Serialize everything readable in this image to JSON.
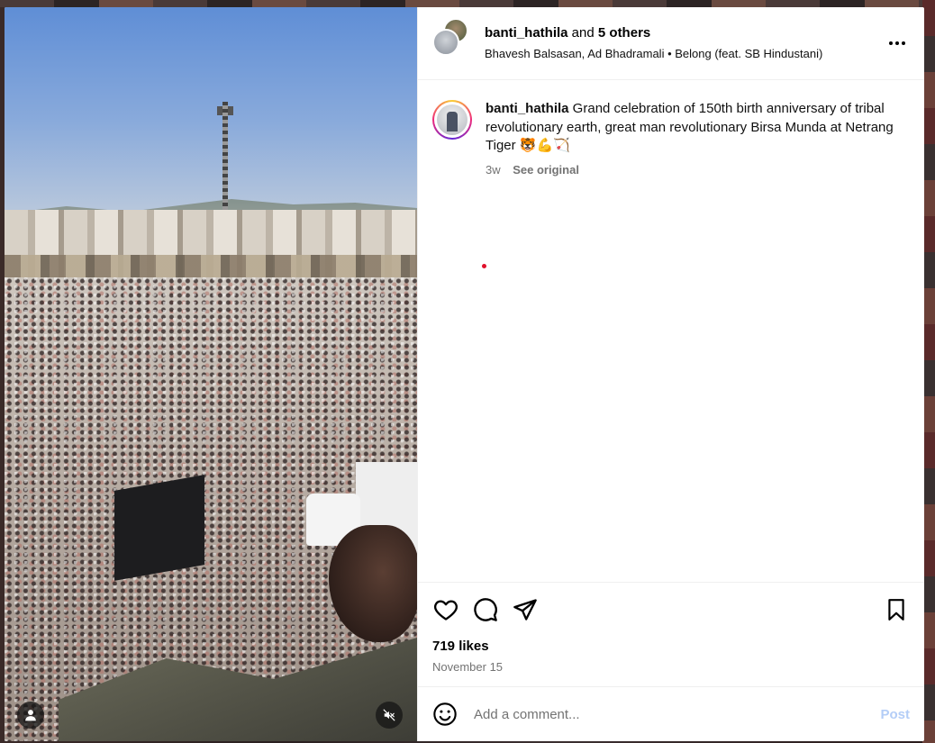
{
  "post": {
    "header": {
      "primary_user": "banti_hathila",
      "joiner": " and ",
      "others": "5 others",
      "collaborators": "Bhavesh Balsasan, Ad Bhadramali",
      "separator": " • ",
      "audio": "Belong (feat. SB Hindustani)"
    },
    "caption": {
      "user": "banti_hathila",
      "text": " Grand celebration of 150th birth anniversary of tribal revolutionary earth, great man revolutionary Birsa Munda at Netrang Tiger 🐯💪🏹",
      "age": "3w",
      "see_original": "See original"
    },
    "stats": {
      "likes": "719 likes",
      "date": "November 15"
    },
    "comment": {
      "placeholder": "Add a comment...",
      "post_label": "Post"
    }
  },
  "icons": {
    "more": "more-options-icon",
    "like": "heart-icon",
    "comment": "comment-icon",
    "share": "share-icon",
    "save": "bookmark-icon",
    "emoji": "emoji-icon",
    "tagged": "user-icon",
    "mute": "muted-speaker-icon"
  },
  "colors": {
    "post_button_disabled": "#b3cdf7",
    "secondary_text": "#737373",
    "notification_dot": "#e0102b"
  }
}
